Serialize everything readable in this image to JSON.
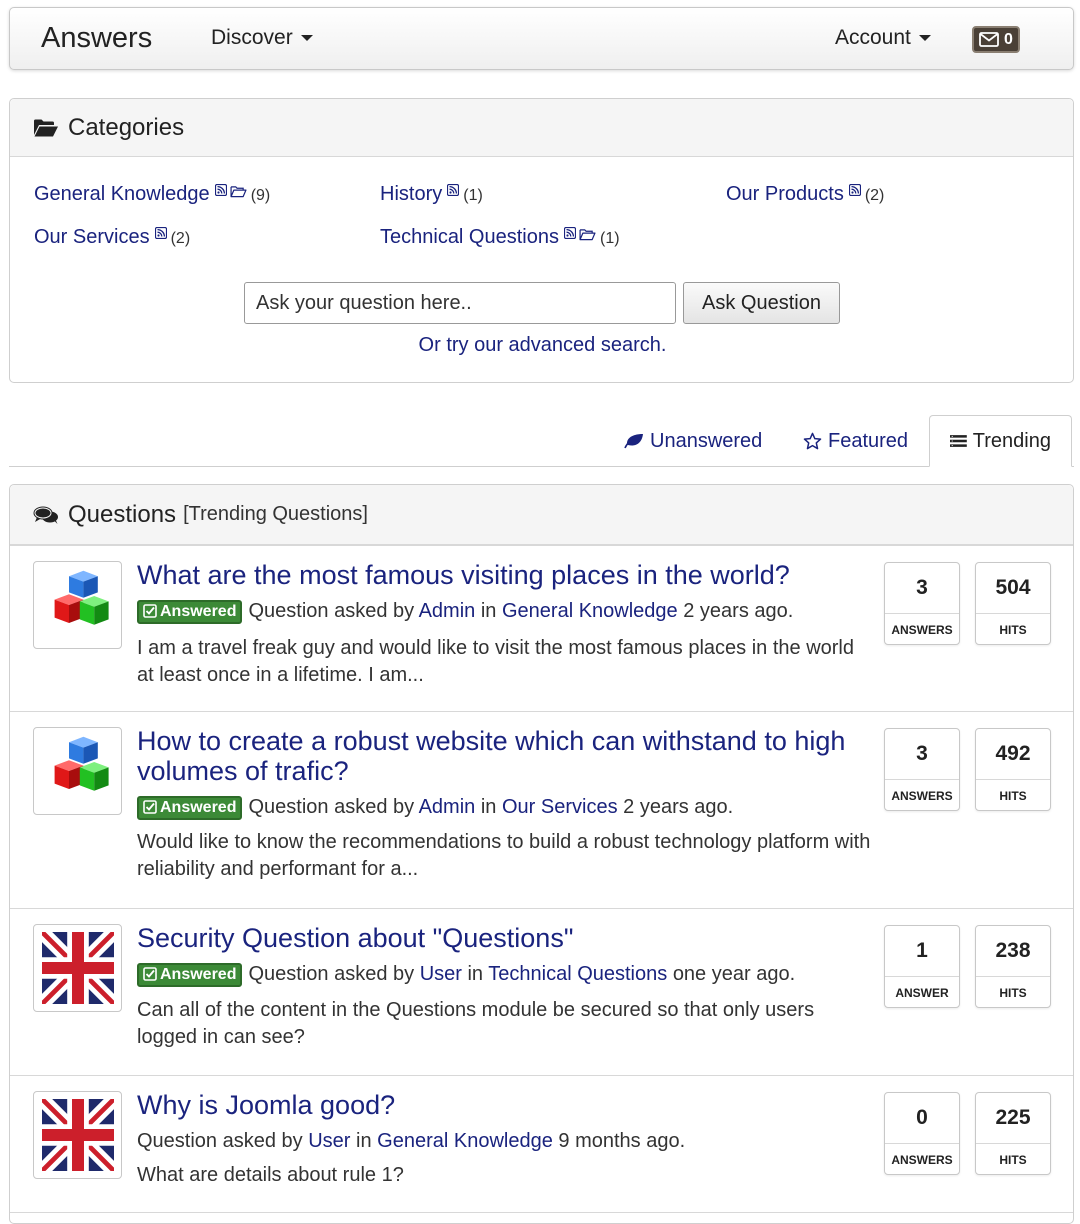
{
  "navbar": {
    "brand": "Answers",
    "discover": "Discover",
    "account": "Account",
    "mail_count": "0"
  },
  "categories": {
    "title": "Categories",
    "items": [
      {
        "name": "General Knowledge",
        "count": "(9)"
      },
      {
        "name": "History",
        "count": "(1)"
      },
      {
        "name": "Our Products",
        "count": "(2)"
      },
      {
        "name": "Our Services",
        "count": "(2)"
      },
      {
        "name": "Technical Questions",
        "count": "(1)"
      }
    ],
    "search_placeholder": "Ask your question here..",
    "ask_button": "Ask Question",
    "advanced_link": "Or try our advanced search."
  },
  "tabs": [
    {
      "label": "Unanswered"
    },
    {
      "label": "Featured"
    },
    {
      "label": "Trending"
    }
  ],
  "questions": {
    "title": "Questions",
    "subtitle": "[Trending Questions]",
    "items": [
      {
        "title": "What are the most famous visiting places in the world?",
        "answered": "Answered",
        "asked_prefix": "Question asked by",
        "user": "Admin",
        "in_word": "in",
        "category": "General Knowledge",
        "time": "2 years ago.",
        "desc": "I am a travel freak guy and would like to visit the most famous places in the world at least once in a lifetime. I am...",
        "answers": "3",
        "answers_label": "ANSWERS",
        "hits": "504",
        "hits_label": "HITS",
        "avatar": "cubes-icon"
      },
      {
        "title": "How to create a robust website which can withstand to high volumes of trafic?",
        "answered": "Answered",
        "asked_prefix": "Question asked by",
        "user": "Admin",
        "in_word": "in",
        "category": "Our Services",
        "time": "2 years ago.",
        "desc": "Would like to know the recommendations to build a robust technology platform with reliability and performant for a...",
        "answers": "3",
        "answers_label": "ANSWERS",
        "hits": "492",
        "hits_label": "HITS",
        "avatar": "cubes-icon"
      },
      {
        "title": "Security Question about \"Questions\"",
        "answered": "Answered",
        "asked_prefix": "Question asked by",
        "user": "User",
        "in_word": "in",
        "category": "Technical Questions",
        "time": "one year ago.",
        "desc": "Can all of the content in the Questions module be secured so that only users logged in can see?",
        "answers": "1",
        "answers_label": "ANSWER",
        "hits": "238",
        "hits_label": "HITS",
        "avatar": "uk-flag-icon"
      },
      {
        "title": "Why is Joomla good?",
        "asked_prefix": "Question asked by",
        "user": "User",
        "in_word": "in",
        "category": "General Knowledge",
        "time": "9 months ago.",
        "desc": "What are details about rule 1?",
        "answers": "0",
        "answers_label": "ANSWERS",
        "hits": "225",
        "hits_label": "HITS",
        "avatar": "uk-flag-icon"
      }
    ]
  },
  "colors": {
    "link": "#1a237e",
    "answered_badge": "#3c8a37",
    "mail_badge": "#4a4036"
  }
}
